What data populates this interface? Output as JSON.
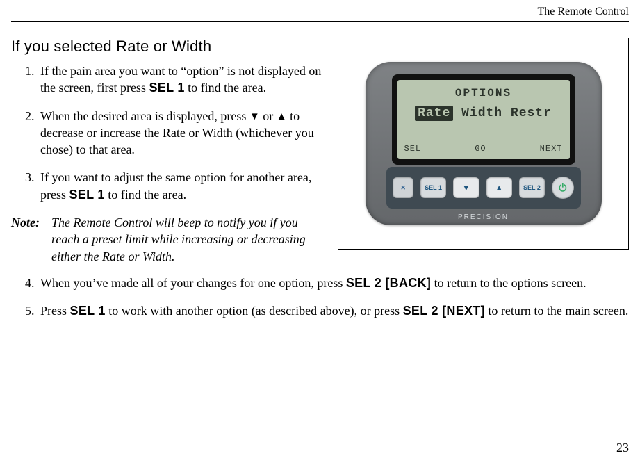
{
  "header": {
    "running_head": "The Remote Control"
  },
  "footer": {
    "page_number": "23"
  },
  "section": {
    "heading": "If you selected Rate or Width"
  },
  "steps_top": {
    "s1a": "If the pain area you want to “option” is not displayed on the screen, first press ",
    "s1b": "SEL 1",
    "s1c": " to find the area.",
    "s2a": "When the desired area is displayed, press ",
    "s2b": " or ",
    "s2c": " to decrease or increase the Rate or Width (whichever you chose) to that area.",
    "s3a": "If you want to adjust the same option for another area, press ",
    "s3b": "SEL 1",
    "s3c": " to find the area."
  },
  "note": {
    "label": "Note:",
    "text": "The Remote Control will beep to notify you if you reach a preset limit while increasing or decreasing either the Rate or Width."
  },
  "steps_bottom": {
    "s4a": "When you’ve made all of your changes for one option, press ",
    "s4b": "SEL 2 [BACK]",
    "s4c": " to return to the options screen.",
    "s5a": "Press ",
    "s5b": "SEL 1",
    "s5c": " to work with another option (as described above), or press ",
    "s5d": "SEL 2 [NEXT]",
    "s5e": " to return to the main screen."
  },
  "glyph": {
    "down": "▼",
    "up": "▲",
    "power": "⏻"
  },
  "device": {
    "lcd": {
      "title": "OPTIONS",
      "opt1": "Rate",
      "opt2": "Width",
      "opt3": "Restr",
      "soft_left": "SEL",
      "soft_mid": "GO",
      "soft_right": "NEXT"
    },
    "buttons": {
      "sel1": "SEL 1",
      "sel2": "SEL 2"
    },
    "brand": "PRECISION"
  }
}
